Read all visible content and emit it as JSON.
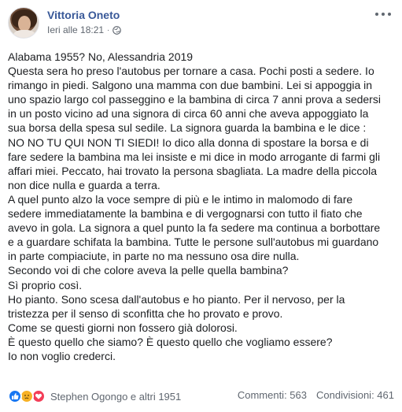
{
  "post": {
    "author": "Vittoria Oneto",
    "timestamp": "Ieri alle 18:21",
    "separator": "·",
    "privacy_icon": "globe-icon",
    "more_icon": "more-options-icon",
    "lines": [
      "Alabama 1955? No, Alessandria 2019",
      "Questa sera ho preso l'autobus per tornare a casa. Pochi posti a sedere. Io",
      "rimango in piedi. Salgono una mamma con due bambini. Lei si appoggia in",
      "uno spazio largo col passeggino e la bambina di circa 7 anni prova a sedersi",
      "in un posto vicino ad una signora di circa 60 anni che aveva appoggiato la",
      "sua borsa della spesa sul sedile. La signora guarda la bambina e le dice :",
      "NO NO TU QUI NON TI SIEDI! Io dico alla donna di spostare la borsa e di",
      "fare sedere la bambina ma lei insiste e mi dice in modo arrogante di farmi gli",
      "affari miei. Peccato, hai trovato la persona sbagliata. La madre della piccola",
      "non dice nulla e guarda a terra.",
      "A quel punto alzo la voce sempre di più e le intimo in malomodo di fare",
      "sedere immediatamente la bambina e di vergognarsi con tutto il fiato che",
      "avevo in gola. La signora a quel punto la fa sedere ma continua a borbottare",
      "e a guardare schifata la bambina. Tutte le persone sull'autobus mi guardano",
      "in parte compiaciute, in parte no ma nessuno osa dire nulla.",
      "Secondo voi di che colore aveva la pelle quella bambina?",
      "Sì proprio così.",
      "Ho pianto. Sono scesa dall'autobus e ho pianto. Per il nervoso, per la",
      "tristezza per il senso di sconfitta che ho provato e provo.",
      "Come se questi giorni non fossero già dolorosi.",
      "È questo quello che siamo? È questo quello che vogliamo essere?",
      "Io non voglio crederci."
    ]
  },
  "footer": {
    "reaction_icons": [
      "like-icon",
      "sad-icon",
      "love-icon"
    ],
    "reactions_text": "Stephen Ogongo e altri 1951",
    "comments": "Commenti: 563",
    "shares": "Condivisioni: 461"
  },
  "colors": {
    "name_link": "#385898",
    "meta_text": "#606770",
    "body_text": "#1c1e21",
    "like": "#1877f2",
    "sad": "#f7b125",
    "love": "#f33e58"
  }
}
